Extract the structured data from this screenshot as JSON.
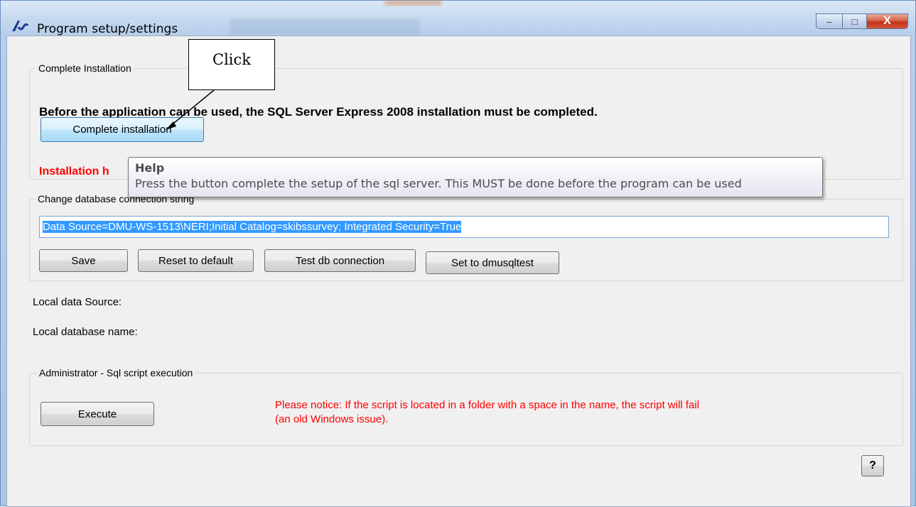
{
  "window": {
    "title": "Program setup/settings",
    "minimize_glyph": "–",
    "maximize_glyph": "□",
    "close_glyph": "X"
  },
  "complete_installation": {
    "legend": "Complete Installation",
    "message": "Before the application can be used, the SQL Server Express 2008 installation must be completed.",
    "button_label": "Complete installation",
    "status_label": "Installation h"
  },
  "tooltip": {
    "title": "Help",
    "body": "Press the button complete the setup of the sql server. This MUST be done before the program can be used"
  },
  "callout": {
    "label": "Click"
  },
  "database": {
    "legend": "Change database connection string",
    "connection_string": "Data Source=DMU-WS-1513\\NERI;Initial Catalog=skibssurvey; Integrated Security=True",
    "save_label": "Save",
    "reset_label": "Reset to default",
    "test_label": "Test db connection",
    "set_label": "Set to dmusqltest"
  },
  "local": {
    "data_source_label": "Local data Source:",
    "database_name_label": "Local database name:"
  },
  "admin": {
    "legend": "Administrator - Sql script execution",
    "execute_label": "Execute",
    "notice_line1": "Please notice: If the script is located in a folder with a space in the name, the script will fail",
    "notice_line2": "(an old Windows issue)."
  },
  "help_button_label": "?",
  "icons": [
    "app-logo-icon",
    "minimize-icon",
    "maximize-icon",
    "close-icon",
    "arrow-annotation"
  ],
  "colors": {
    "warning_red": "#ff0000",
    "selection_blue": "#3399ff",
    "client_bg": "#f0f0f0"
  }
}
